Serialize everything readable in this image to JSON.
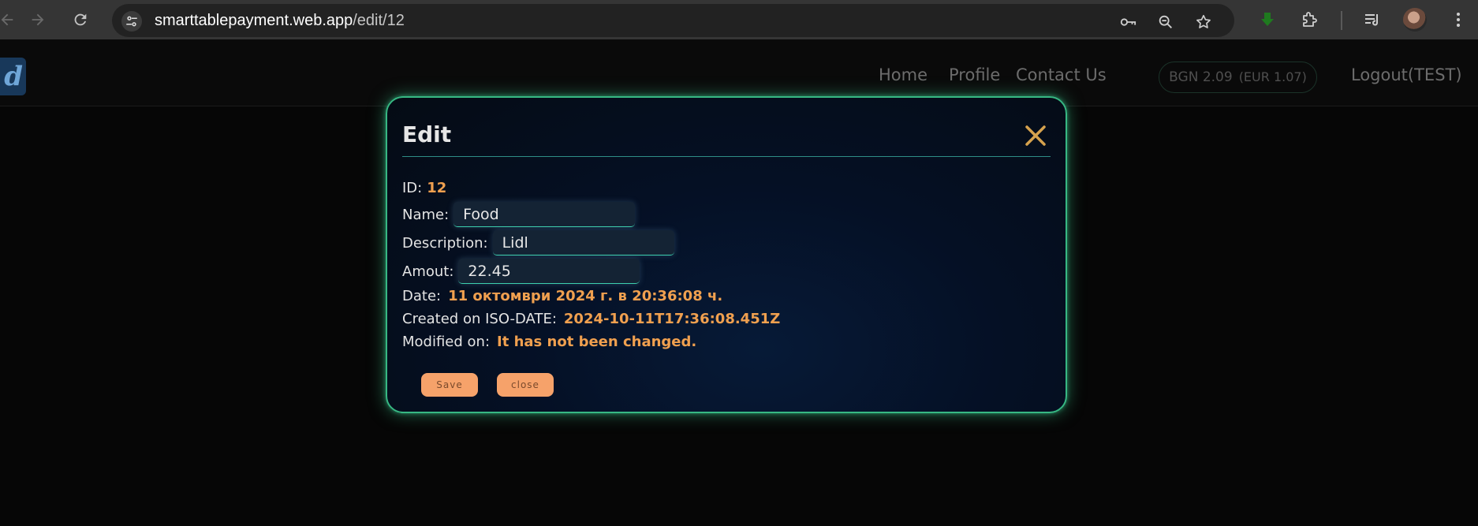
{
  "browser": {
    "url_host": "smarttablepayment.web.app",
    "url_path": "/edit/12",
    "icons": [
      "back-icon",
      "forward-icon",
      "reload-icon",
      "site-settings-icon",
      "password-key-icon",
      "zoom-icon",
      "bookmark-star-icon",
      "download-arrow-icon",
      "extensions-icon",
      "reading-list-icon",
      "profile-avatar",
      "menu-icon"
    ]
  },
  "header": {
    "logo_text": "d",
    "nav": [
      "Home",
      "Profile",
      "Contact Us"
    ],
    "currency_bgn": "BGN 2.09",
    "currency_eur": "(EUR 1.07)",
    "logout": "Logout(TEST)"
  },
  "modal": {
    "title": "Edit",
    "id_label": "ID:",
    "id_value": "12",
    "name_label": "Name:",
    "name_value": "Food",
    "description_label": "Description:",
    "description_value": "Lidl",
    "amount_label": "Amout:",
    "amount_value": "22.45",
    "date_label": "Date:",
    "date_value": "11 октомври 2024 г. в 20:36:08 ч.",
    "created_label": "Created on ISO-DATE:",
    "created_value": "2024-10-11T17:36:08.451Z",
    "modified_label": "Modified on:",
    "modified_value": "It has not been changed.",
    "save_label": "Save",
    "close_label": "close"
  },
  "colors": {
    "accent_orange": "#f0a04f",
    "button_orange": "#f6a26a",
    "modal_border_green": "#37b883",
    "background": "#060606"
  }
}
